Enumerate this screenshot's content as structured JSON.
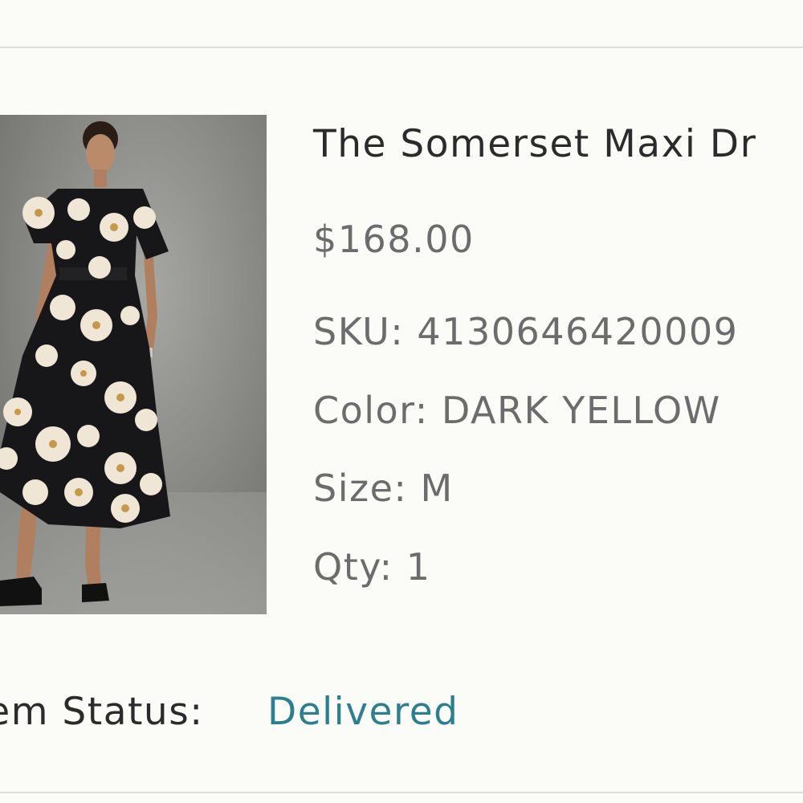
{
  "order_item": {
    "title": "The Somerset Maxi Dr",
    "price": "$168.00",
    "sku": "SKU: 4130646420009",
    "color": "Color: DARK YELLOW",
    "size": "Size: M",
    "qty": "Qty: 1",
    "status_label": "Item Status:",
    "status_value": "Delivered"
  },
  "colors": {
    "background": "#fbfbf8",
    "divider": "#dcdcd8",
    "title_text": "#2b2b2e",
    "detail_text": "#6c6c6e",
    "status_accent": "#2e7f8e"
  }
}
